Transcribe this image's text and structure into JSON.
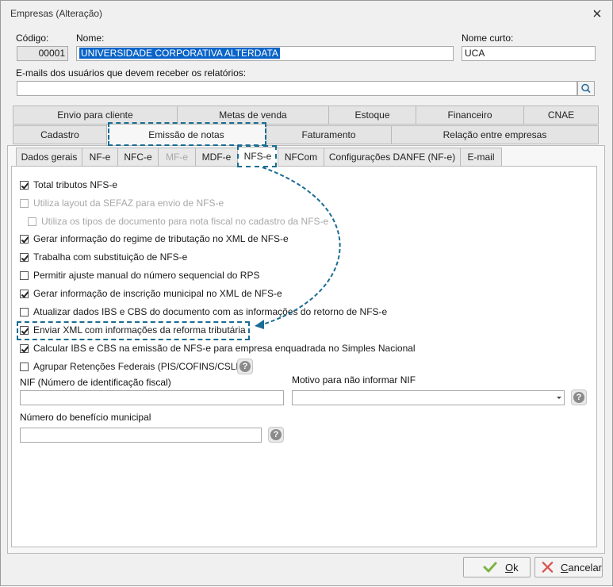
{
  "window": {
    "title": "Empresas (Alteração)"
  },
  "form": {
    "codigo_label": "Código:",
    "codigo_value": "00001",
    "nome_label": "Nome:",
    "nome_value": "UNIVERSIDADE CORPORATIVA ALTERDATA",
    "nome_curto_label": "Nome curto:",
    "nome_curto_value": "UCA",
    "emails_label": "E-mails dos usuários que devem receber os relatórios:",
    "emails_value": ""
  },
  "tabs_row1": [
    {
      "label": "Envio para cliente"
    },
    {
      "label": "Metas de venda"
    },
    {
      "label": "Estoque"
    },
    {
      "label": "Financeiro"
    },
    {
      "label": "CNAE"
    }
  ],
  "tabs_row2": [
    {
      "label": "Cadastro"
    },
    {
      "label": "Emissão de notas",
      "active": true
    },
    {
      "label": "Faturamento"
    },
    {
      "label": "Relação entre empresas"
    }
  ],
  "subtabs": [
    {
      "label": "Dados gerais"
    },
    {
      "label": "NF-e"
    },
    {
      "label": "NFC-e"
    },
    {
      "label": "MF-e",
      "disabled": true
    },
    {
      "label": "MDF-e"
    },
    {
      "label": "NFS-e",
      "active": true
    },
    {
      "label": "NFCom"
    },
    {
      "label": "Configurações DANFE (NF-e)"
    },
    {
      "label": "E-mail"
    }
  ],
  "options": [
    {
      "label": "Total tributos NFS-e",
      "checked": true,
      "disabled": false
    },
    {
      "label": "Utiliza layout da SEFAZ para envio de NFS-e",
      "checked": false,
      "disabled": true
    },
    {
      "label": "Utiliza os tipos de documento para nota fiscal no cadastro da NFS-e",
      "checked": false,
      "disabled": true
    },
    {
      "label": "Gerar informação do regime de tributação no XML de NFS-e",
      "checked": true,
      "disabled": false
    },
    {
      "label": "Trabalha com substituição de NFS-e",
      "checked": true,
      "disabled": false
    },
    {
      "label": "Permitir ajuste manual do número sequencial do RPS",
      "checked": false,
      "disabled": false
    },
    {
      "label": "Gerar informação de inscrição municipal no XML de NFS-e",
      "checked": true,
      "disabled": false
    },
    {
      "label": "Atualizar dados IBS e CBS do documento com as informações do retorno de NFS-e",
      "checked": false,
      "disabled": false
    },
    {
      "label": "Enviar XML com informações da reforma tributária",
      "checked": true,
      "disabled": false
    },
    {
      "label": "Calcular IBS e CBS na emissão de NFS-e para empresa enquadrada no Simples Nacional",
      "checked": true,
      "disabled": false
    },
    {
      "label": "Agrupar Retenções Federais (PIS/COFINS/CSLL)",
      "checked": false,
      "disabled": false
    }
  ],
  "nif": {
    "label": "NIF (Número de identificação fiscal)",
    "value": ""
  },
  "motivo": {
    "label": "Motivo para não informar NIF",
    "value": ""
  },
  "beneficio": {
    "label": "Número do benefício municipal",
    "value": ""
  },
  "buttons": {
    "ok_underline": "O",
    "ok_rest": "k",
    "cancel_underline": "C",
    "cancel_rest": "ancelar"
  },
  "colors": {
    "accent": "#1a6d94",
    "selection": "#0a64c8",
    "ok_icon": "#7cb342",
    "cancel_icon": "#d9534f"
  },
  "icons": [
    "close-icon",
    "search-icon",
    "help-icon",
    "chevron-down-icon",
    "check-icon",
    "x-icon",
    "arrow-icon"
  ]
}
